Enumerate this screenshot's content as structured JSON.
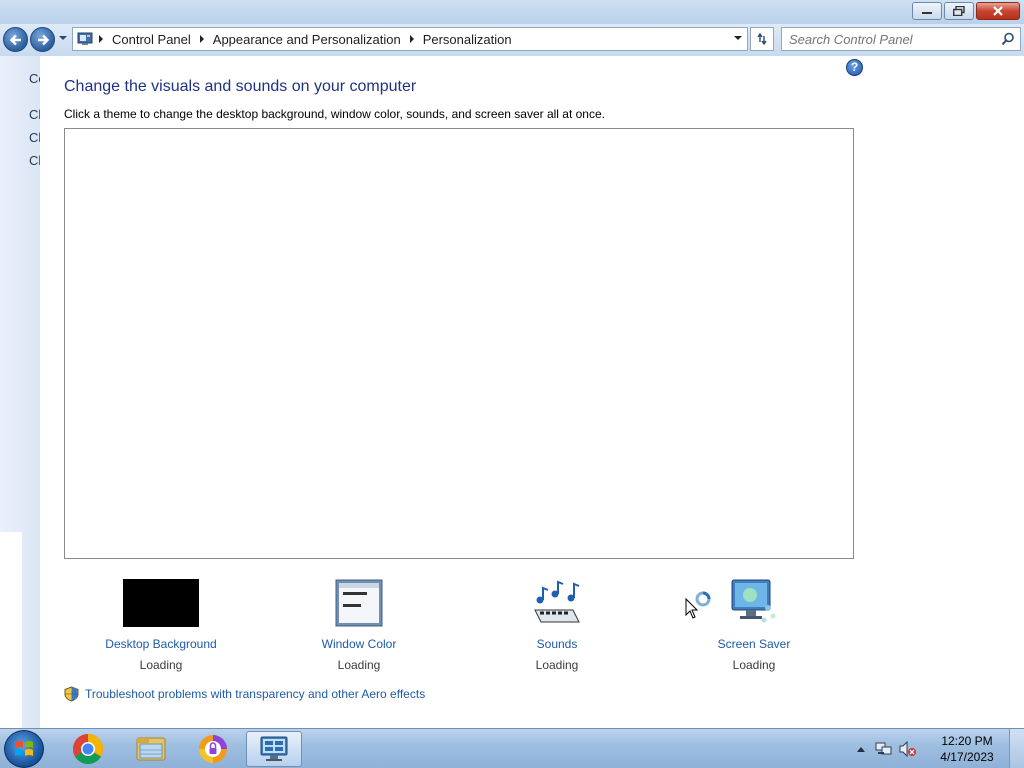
{
  "window": {
    "minimize_icon": "minimize-icon",
    "maximize_icon": "restore-icon",
    "close_icon": "close-icon"
  },
  "address_bar": {
    "breadcrumbs": [
      "Control Panel",
      "Appearance and Personalization",
      "Personalization"
    ],
    "search_placeholder": "Search Control Panel"
  },
  "left_pane": {
    "items": [
      "Co",
      "Ch",
      "Ch",
      "Ch"
    ]
  },
  "main": {
    "heading": "Change the visuals and sounds on your computer",
    "subtext": "Click a theme to change the desktop background, window color, sounds, and screen saver all at once.",
    "options": [
      {
        "label": "Desktop Background",
        "status": "Loading"
      },
      {
        "label": "Window Color",
        "status": "Loading"
      },
      {
        "label": "Sounds",
        "status": "Loading"
      },
      {
        "label": "Screen Saver",
        "status": "Loading"
      }
    ],
    "troubleshoot_link": "Troubleshoot problems with transparency and other Aero effects",
    "help": "?"
  },
  "taskbar": {
    "apps": [
      "chrome-icon",
      "file-explorer-icon",
      "security-app-icon",
      "personalization-icon"
    ],
    "time": "12:20 PM",
    "date": "4/17/2023"
  },
  "colors": {
    "heading": "#1e3287",
    "link": "#1e5aa8"
  }
}
